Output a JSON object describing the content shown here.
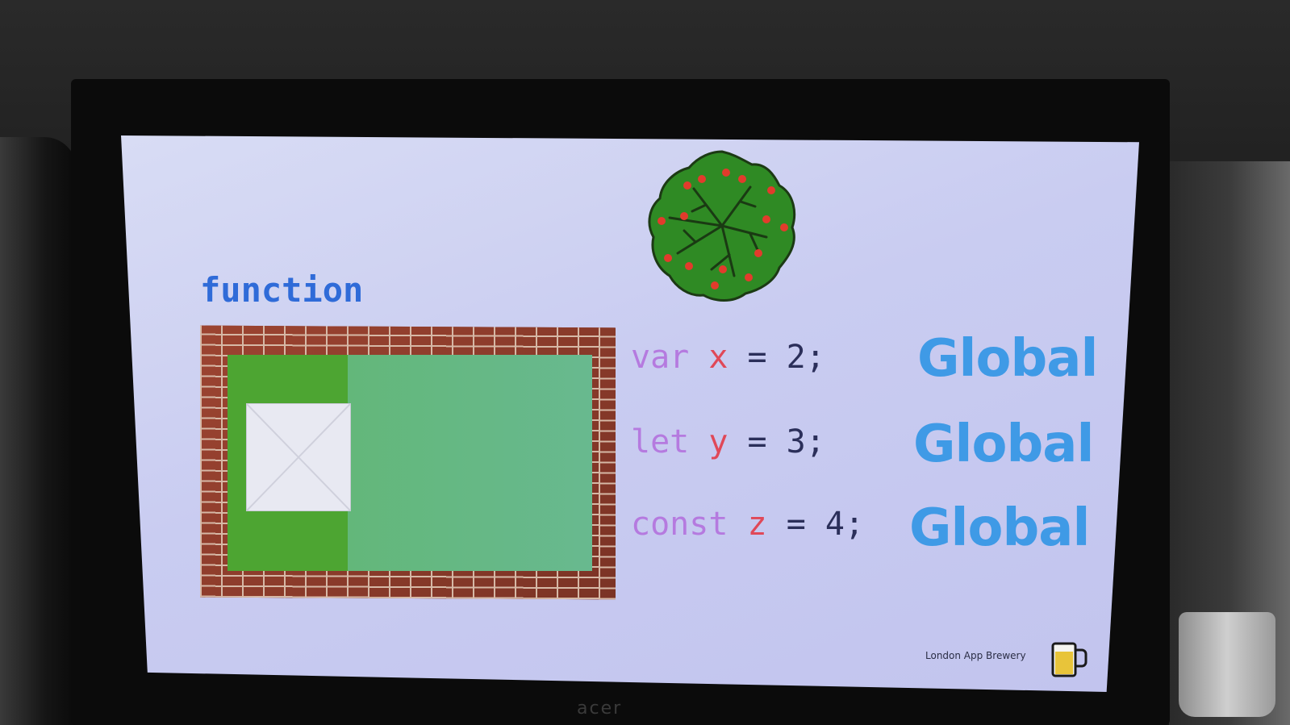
{
  "slide": {
    "function_label": "function",
    "code_lines": [
      {
        "keyword": "var",
        "name": "x",
        "rest": " = 2;",
        "scope": "Global"
      },
      {
        "keyword": "let",
        "name": "y",
        "rest": " = 3;",
        "scope": "Global"
      },
      {
        "keyword": "const",
        "name": "z",
        "rest": " = 4;",
        "scope": "Global"
      }
    ],
    "credit": "London App Brewery"
  },
  "monitor": {
    "brand": "acer"
  },
  "colors": {
    "keyword": "#b57adf",
    "variable": "#e04858",
    "scope": "#3f9ae6",
    "function_label": "#2f6bd8"
  },
  "icons": [
    "tree-icon",
    "beer-mug-icon"
  ]
}
